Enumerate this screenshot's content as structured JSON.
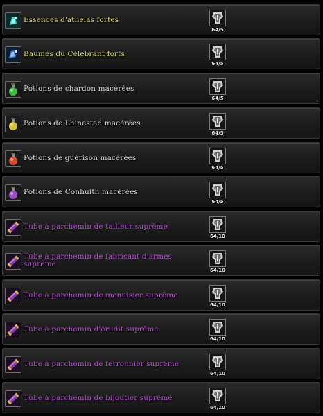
{
  "items": [
    {
      "name": "Essences d'athelas fortes",
      "quantity": "64/5",
      "color": "yellow",
      "icon": "athelas-essence-icon"
    },
    {
      "name": "Baumes du Célébrant forts",
      "quantity": "64/5",
      "color": "yellow",
      "icon": "celebrant-balm-icon"
    },
    {
      "name": "Potions de chardon macérées",
      "quantity": "64/5",
      "color": "white",
      "icon": "potion-icon"
    },
    {
      "name": "Potions de Lhinestad macérées",
      "quantity": "64/5",
      "color": "white",
      "icon": "potion-icon"
    },
    {
      "name": "Potions de guérison macérées",
      "quantity": "64/5",
      "color": "white",
      "icon": "potion-icon"
    },
    {
      "name": "Potions de Conhuith macérées",
      "quantity": "64/5",
      "color": "white",
      "icon": "potion-icon"
    },
    {
      "name": "Tube à parchemin de tailleur suprême",
      "quantity": "64/10",
      "color": "purple",
      "icon": "scroll-case-icon"
    },
    {
      "name": "Tube à parchemin de fabricant d'armes suprême",
      "quantity": "64/10",
      "color": "purple",
      "icon": "scroll-case-icon"
    },
    {
      "name": "Tube à parchemin de menuisier suprême",
      "quantity": "64/10",
      "color": "purple",
      "icon": "scroll-case-icon"
    },
    {
      "name": "Tube à parchemin d'érudit suprême",
      "quantity": "64/10",
      "color": "purple",
      "icon": "scroll-case-icon"
    },
    {
      "name": "Tube à parchemin de ferronnier suprême",
      "quantity": "64/10",
      "color": "purple",
      "icon": "scroll-case-icon"
    },
    {
      "name": "Tube à parchemin de bijoutier suprême",
      "quantity": "64/10",
      "color": "purple",
      "icon": "scroll-case-icon"
    }
  ],
  "currency_icon": "token-icon"
}
